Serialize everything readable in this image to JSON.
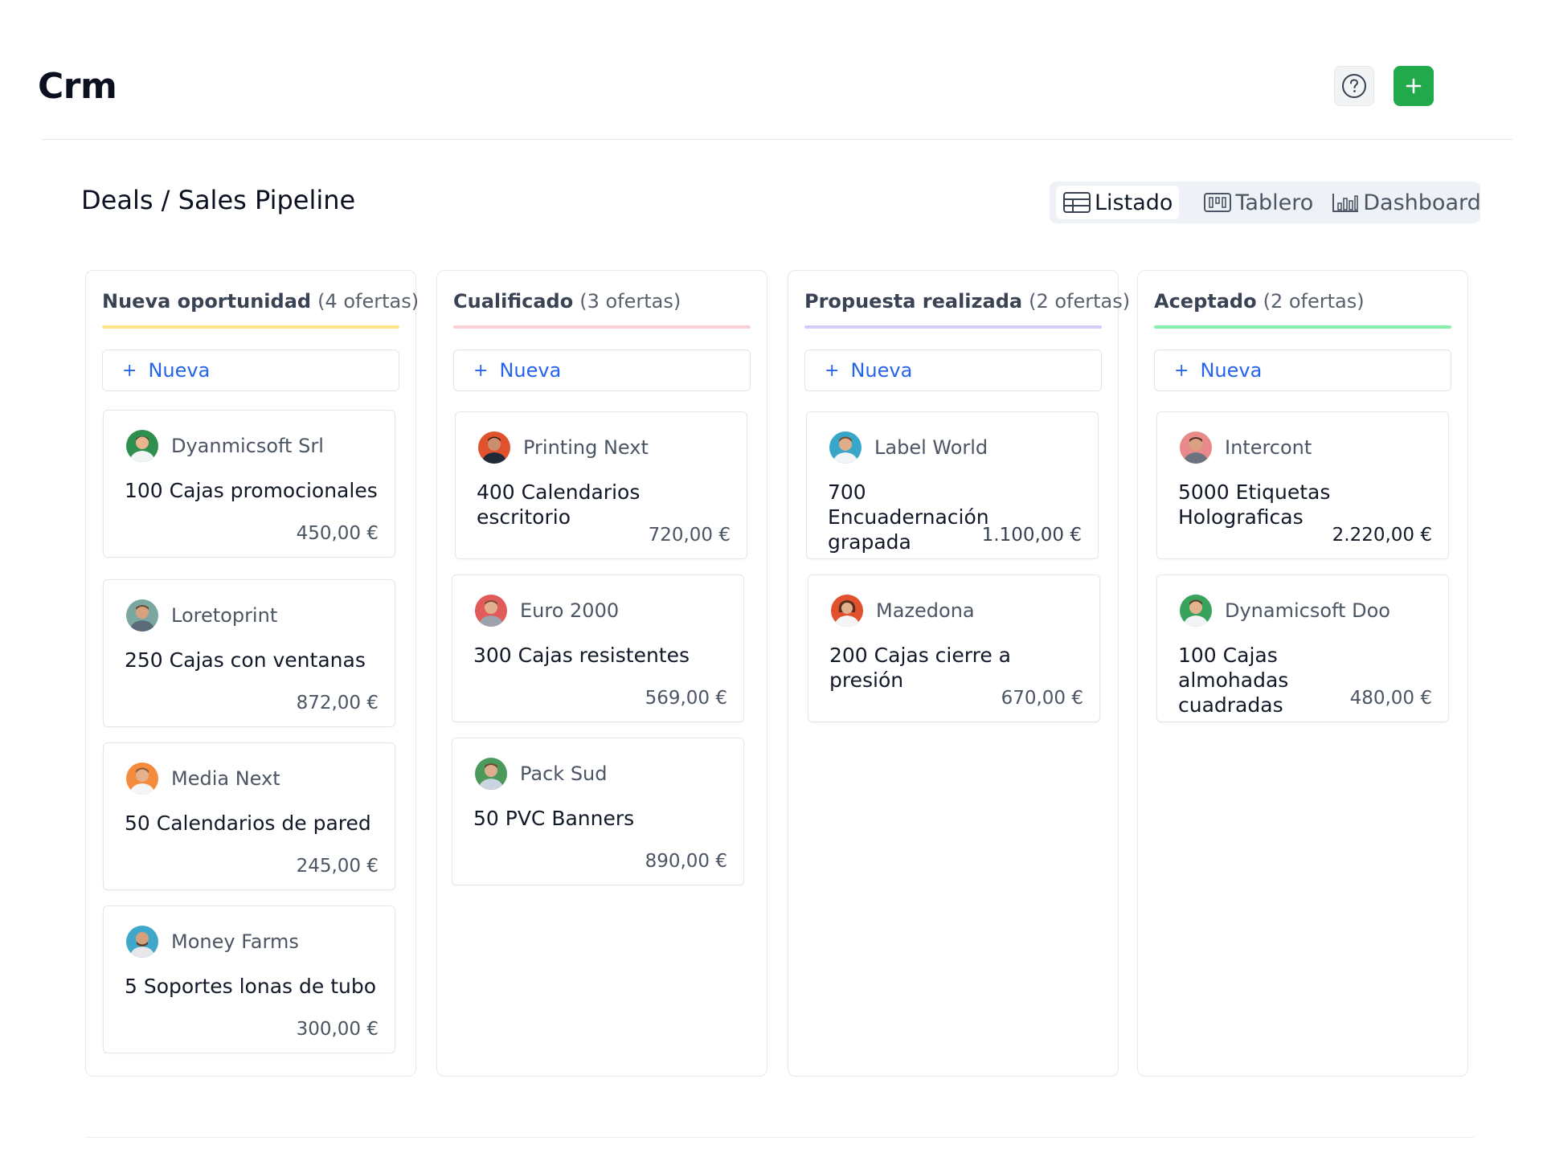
{
  "app": {
    "title": "Crm",
    "help_icon": "question-circle-icon",
    "add_icon": "plus-icon",
    "accent_green": "#22a94b"
  },
  "page": {
    "breadcrumb": "Deals / Sales Pipeline"
  },
  "views": {
    "listado": "Listado",
    "tablero": "Tablero",
    "dashboard": "Dashboard",
    "active": "Listado"
  },
  "new_label": "Nueva",
  "columns": [
    {
      "title": "Nueva oportunidad",
      "count": "(4 ofertas)",
      "color": "#fde68a",
      "cards": [
        {
          "company": "Dyanmicsoft Srl",
          "title": "100 Cajas promocionales",
          "amount": "450,00 €"
        },
        {
          "company": "Loretoprint",
          "title": "250 Cajas con ventanas",
          "amount": "872,00 €"
        },
        {
          "company": "Media Next",
          "title": "50 Calendarios de pared",
          "amount": "245,00 €"
        },
        {
          "company": "Money Farms",
          "title": "5 Soportes lonas de tubo",
          "amount": "300,00 €"
        }
      ]
    },
    {
      "title": "Cualificado",
      "count": "(3 ofertas)",
      "color": "#fbcfd6",
      "cards": [
        {
          "company": "Printing Next",
          "title": "400 Calendarios escritorio",
          "amount": "720,00 €"
        },
        {
          "company": "Euro 2000",
          "title": "300 Cajas resistentes",
          "amount": "569,00 €"
        },
        {
          "company": "Pack Sud",
          "title": "50 PVC Banners",
          "amount": "890,00 €"
        }
      ]
    },
    {
      "title": "Propuesta realizada",
      "count": "(2 ofertas)",
      "color": "#d4cdfb",
      "cards": [
        {
          "company": "Label World",
          "title": "700 Encuadernación grapada",
          "amount": "1.100,00 €"
        },
        {
          "company": "Mazedona",
          "title": "200 Cajas cierre a presión",
          "amount": "670,00 €"
        }
      ]
    },
    {
      "title": "Aceptado",
      "count": "(2 ofertas)",
      "color": "#86efac",
      "cards": [
        {
          "company": "Intercont",
          "title": "5000 Etiquetas Holograficas",
          "amount": "2.220,00 €"
        },
        {
          "company": "Dynamicsoft Doo",
          "title": "100 Cajas almohadas cuadradas",
          "amount": "480,00 €"
        }
      ]
    }
  ]
}
